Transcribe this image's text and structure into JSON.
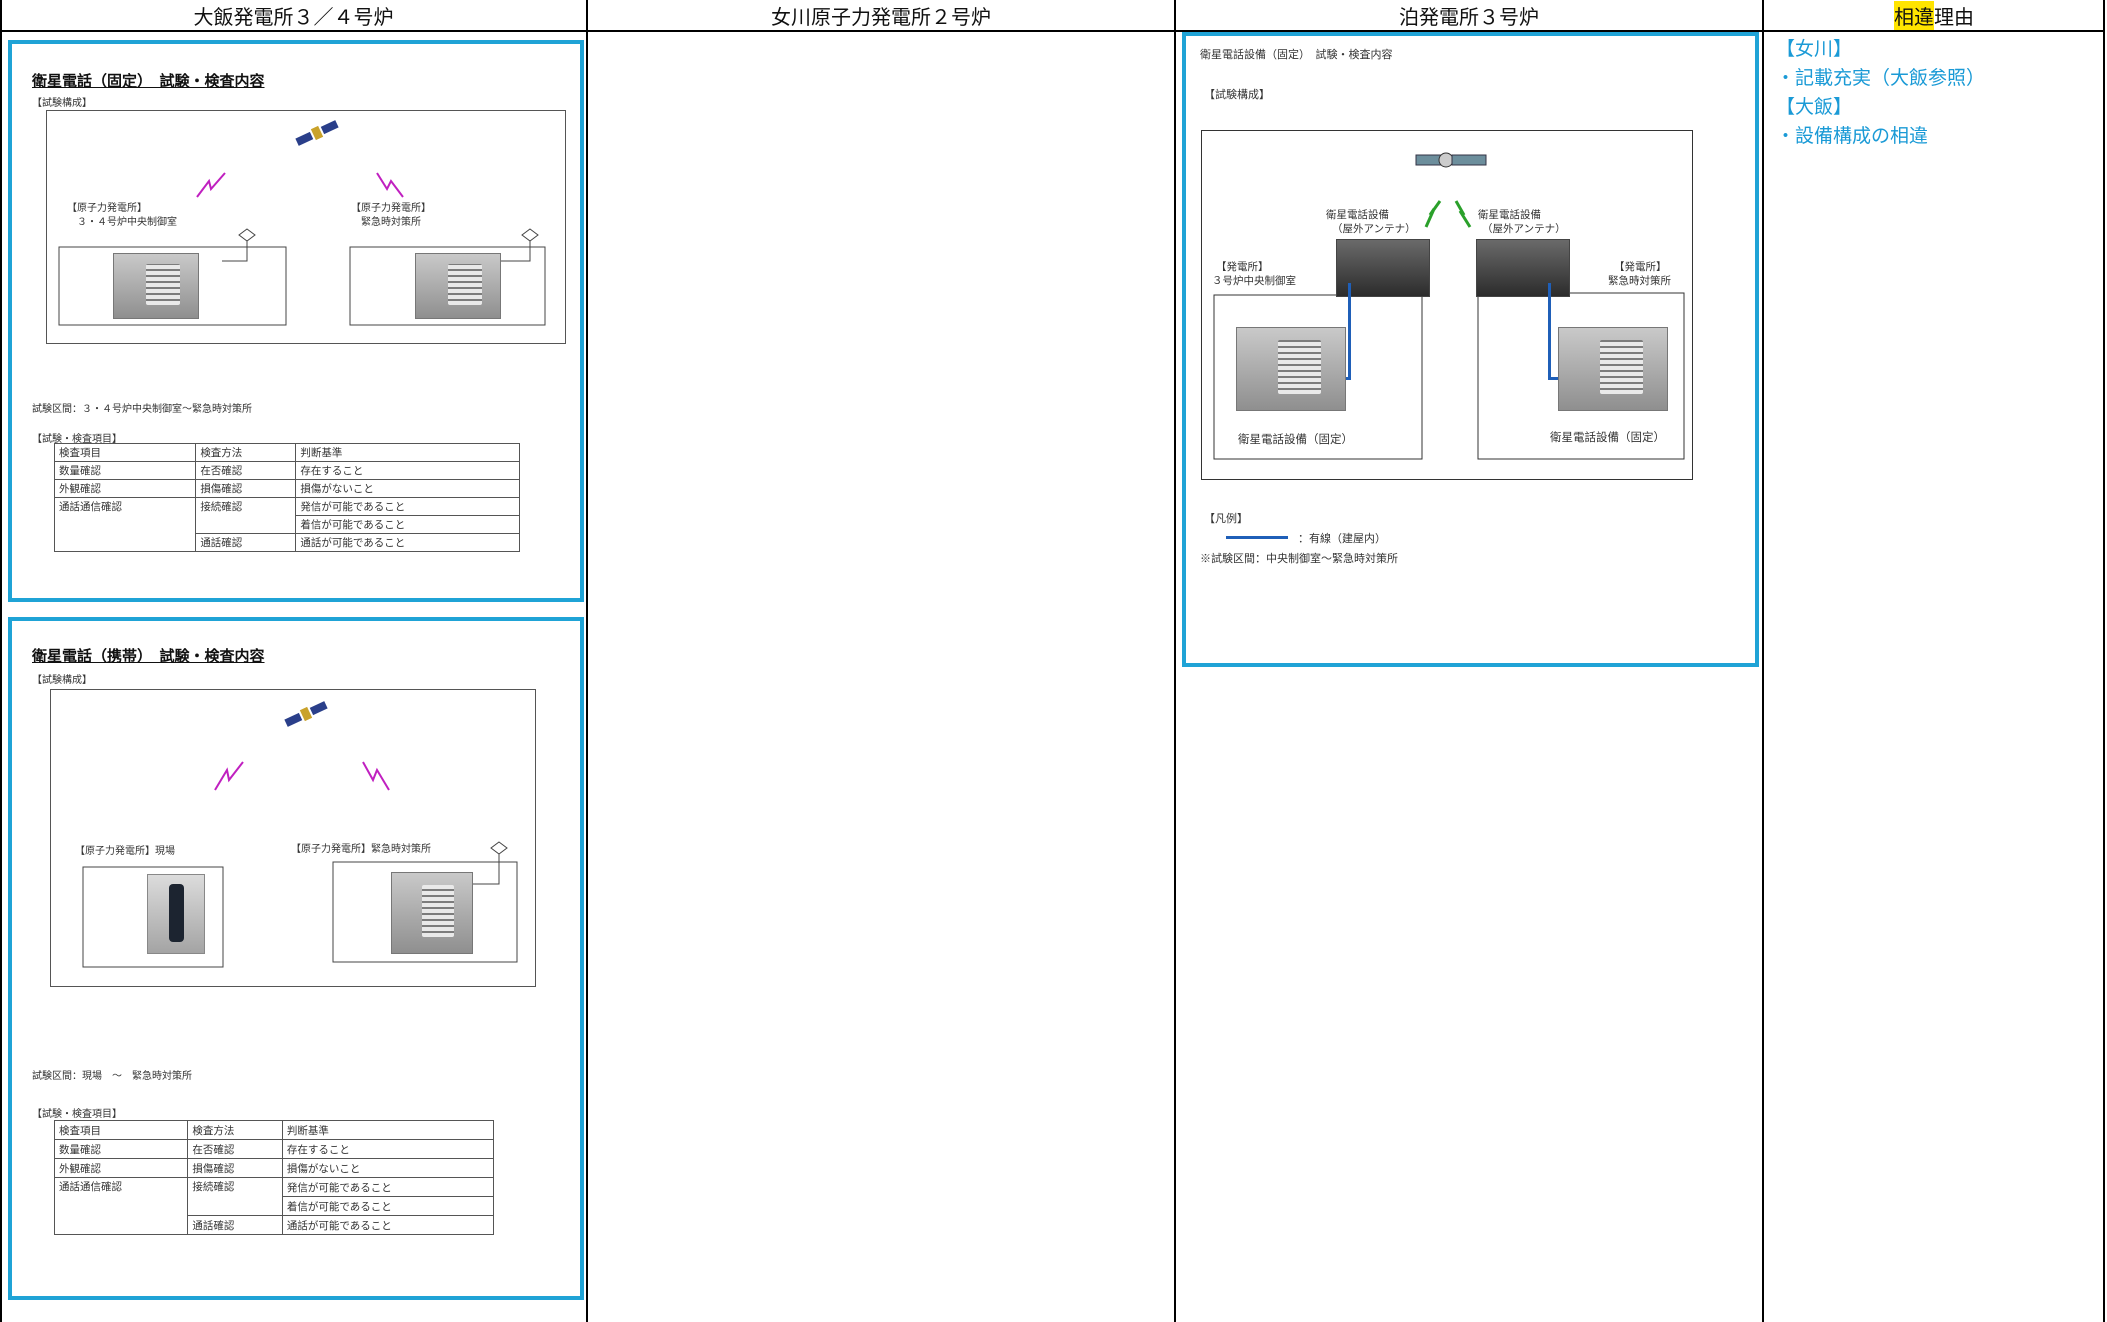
{
  "header": {
    "col1": "大飯発電所３／４号炉",
    "col2": "女川原子力発電所２号炉",
    "col3": "泊発電所３号炉",
    "col4_highlight": "相違",
    "col4_rest": "理由"
  },
  "ohi_fixed": {
    "title": "衛星電話（固定）　試験・検査内容",
    "config_label": "【試験構成】",
    "left_station": "【原子力発電所】",
    "left_location": "３・４号炉中央制御室",
    "right_station": "【原子力発電所】",
    "right_location": "緊急時対策所",
    "section": "試験区間：３・４号炉中央制御室～緊急時対策所",
    "items_label": "【試験・検査項目】",
    "table": [
      [
        "検査項目",
        "検査方法",
        "判断基準"
      ],
      [
        "数量確認",
        "在否確認",
        "存在すること"
      ],
      [
        "外観確認",
        "損傷確認",
        "損傷がないこと"
      ],
      [
        "通話通信確認",
        "接続確認",
        "発信が可能であること"
      ],
      [
        "",
        "",
        "着信が可能であること"
      ],
      [
        "",
        "通話確認",
        "通話が可能であること"
      ]
    ]
  },
  "ohi_mobile": {
    "title": "衛星電話（携帯）　試験・検査内容",
    "config_label": "【試験構成】",
    "left_label": "【原子力発電所】現場",
    "right_label": "【原子力発電所】緊急時対策所",
    "section": "試験区間：現場　～　緊急時対策所",
    "items_label": "【試験・検査項目】",
    "table": [
      [
        "検査項目",
        "検査方法",
        "判断基準"
      ],
      [
        "数量確認",
        "在否確認",
        "存在すること"
      ],
      [
        "外観確認",
        "損傷確認",
        "損傷がないこと"
      ],
      [
        "通話通信確認",
        "接続確認",
        "発信が可能であること"
      ],
      [
        "",
        "",
        "着信が可能であること"
      ],
      [
        "",
        "通話確認",
        "通話が可能であること"
      ]
    ]
  },
  "tomari": {
    "title": "衛星電話設備（固定）　試験・検査内容",
    "config_label": "【試験構成】",
    "antenna_left_1": "衛星電話設備",
    "antenna_left_2": "（屋外アンテナ）",
    "antenna_right_1": "衛星電話設備",
    "antenna_right_2": "（屋外アンテナ）",
    "left_station": "【発電所】",
    "left_location": "３号炉中央制御室",
    "right_station": "【発電所】",
    "right_location": "緊急時対策所",
    "left_caption": "衛星電話設備（固定）",
    "right_caption": "衛星電話設備（固定）",
    "legend_label": "【凡例】",
    "legend_text": "：有線（建屋内）",
    "section": "※試験区間：中央制御室～緊急時対策所"
  },
  "reasons": [
    "【女川】",
    "・記載充実（大飯参照）",
    "【大飯】",
    "・設備構成の相違"
  ],
  "colors": {
    "panel_border": "#1fa3d6",
    "reason_text": "#1a9ad6",
    "highlight": "#ffe400",
    "wire": "#1f5fb8",
    "bolt_ohi": "#c020c0",
    "bolt_tomari": "#2aa02a"
  }
}
